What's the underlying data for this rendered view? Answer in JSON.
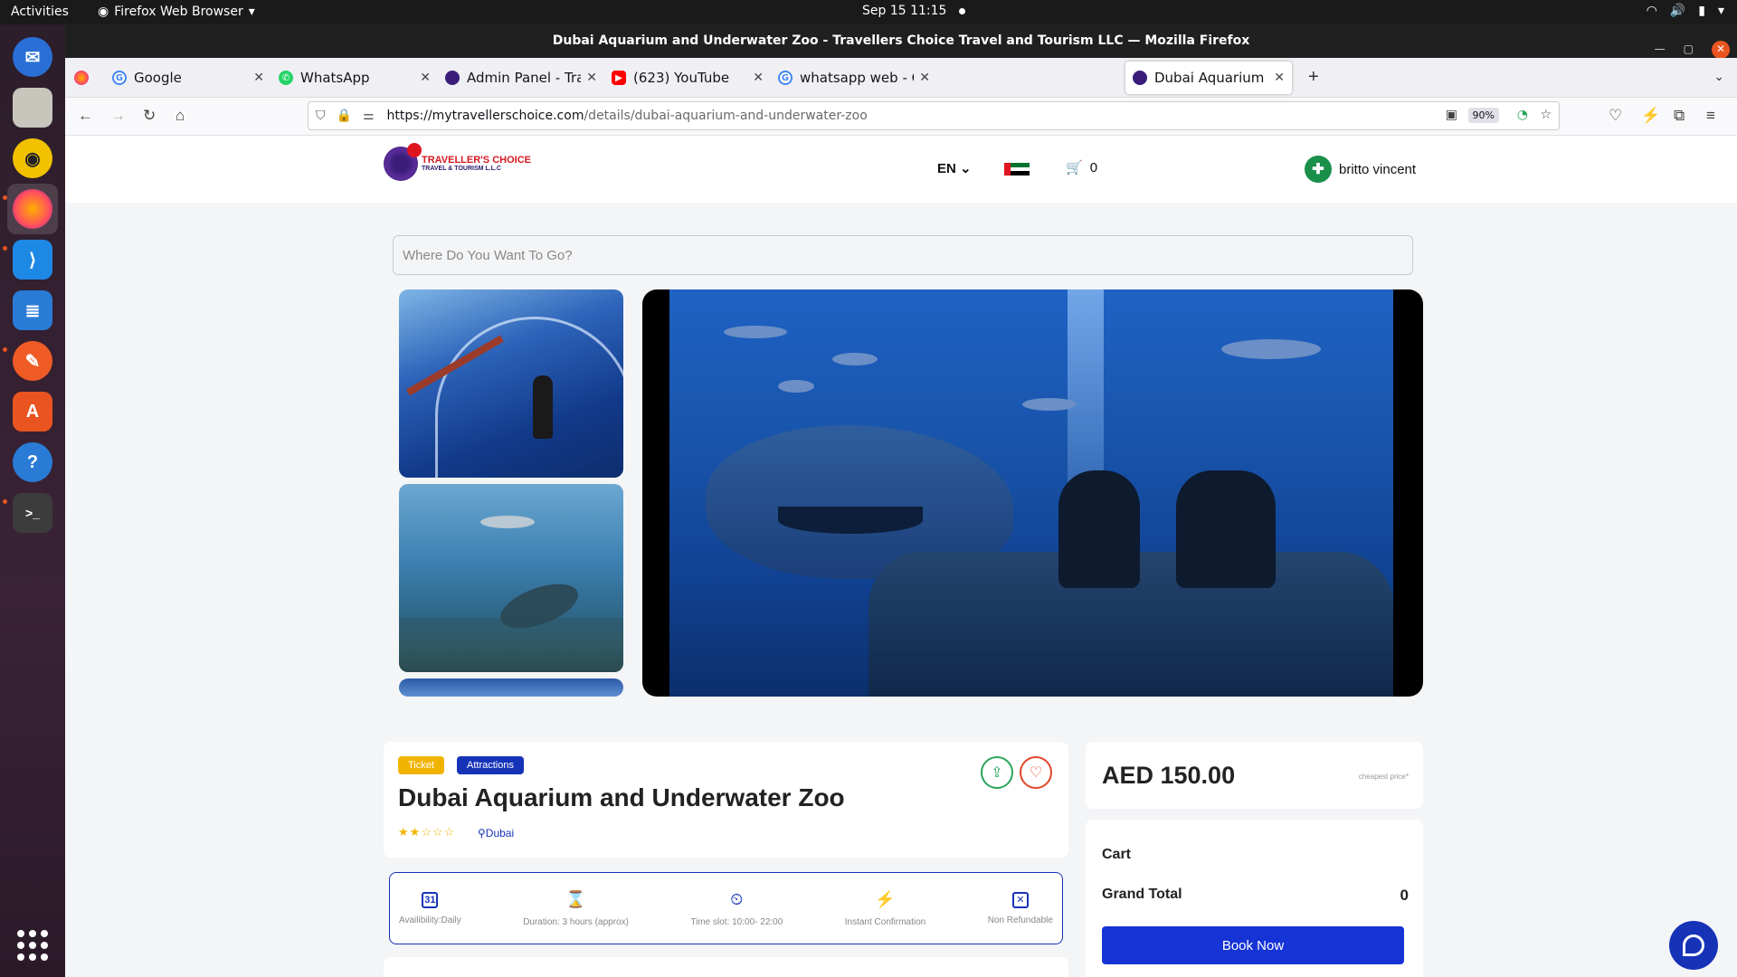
{
  "system": {
    "activities": "Activities",
    "app_menu": "Firefox Web Browser",
    "clock": "Sep 15  11:15"
  },
  "window": {
    "title": "Dubai Aquarium and Underwater Zoo - Travellers Choice Travel and Tourism LLC — Mozilla Firefox"
  },
  "tabs": [
    {
      "label": "Google",
      "icon": "google-icon",
      "color": "#4285f4"
    },
    {
      "label": "WhatsApp",
      "icon": "whatsapp-icon",
      "color": "#25d366"
    },
    {
      "label": "Admin Panel - Travellers C",
      "icon": "admin-icon",
      "color": "#3a1d78"
    },
    {
      "label": "(623) YouTube",
      "icon": "youtube-icon",
      "color": "#ff0000"
    },
    {
      "label": "whatsapp web - Google S",
      "icon": "google-icon",
      "color": "#4285f4"
    },
    {
      "label": "Dubai Aquarium and Und",
      "icon": "site-icon",
      "color": "#3a1d78",
      "selected": true
    }
  ],
  "urlbar": {
    "url_domain": "https://mytravellerschoice.com",
    "url_path": "/details/dubai-aquarium-and-underwater-zoo",
    "zoom": "90%"
  },
  "header": {
    "logo_line1": "TRAVELLER'S CHOICE",
    "logo_line2": "TRAVEL & TOURISM L.L.C",
    "language": "EN",
    "cart_count": "0",
    "user_name": "britto vincent"
  },
  "search": {
    "placeholder": "Where Do You Want To Go?"
  },
  "product": {
    "tags": [
      "Ticket",
      "Attractions"
    ],
    "title": "Dubai Aquarium and Underwater Zoo",
    "rating": 2,
    "rating_max": 5,
    "location": "Dubai"
  },
  "features": [
    {
      "label": "Availibility:Daily",
      "icon": "calendar-icon",
      "glyph": "31"
    },
    {
      "label": "Duration: 3 hours (approx)",
      "icon": "hourglass-icon",
      "glyph": "⌛"
    },
    {
      "label": "Time slot: 10:00- 22:00",
      "icon": "clock-icon",
      "glyph": "⏲"
    },
    {
      "label": "Instant Confirmation",
      "icon": "lightning-icon",
      "glyph": "⚡"
    },
    {
      "label": "Non Refundable",
      "icon": "calendar-x-icon",
      "glyph": "✕"
    }
  ],
  "pricing": {
    "price": "AED 150.00",
    "note": "cheapest price*"
  },
  "cart": {
    "title": "Cart",
    "grand_total_label": "Grand Total",
    "grand_total_value": "0",
    "book_label": "Book Now"
  },
  "colors": {
    "primary": "#1633b8",
    "ticket_tag": "#f0b400",
    "book_button": "#1633d6"
  }
}
